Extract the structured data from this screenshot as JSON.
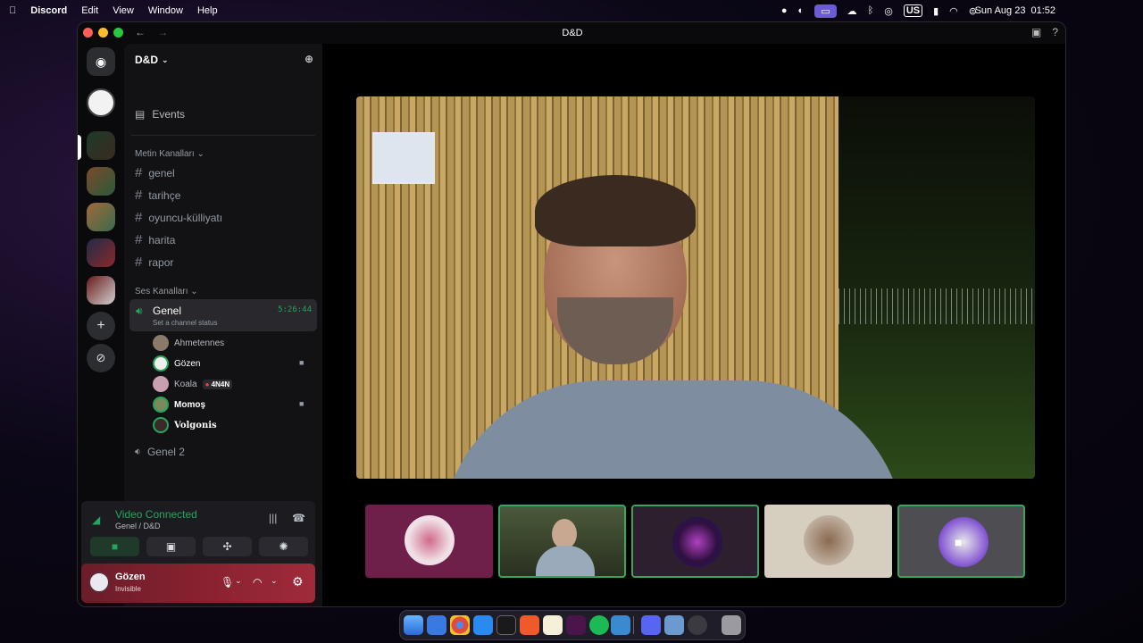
{
  "menubar": {
    "app_name": "Discord",
    "menus": [
      "Edit",
      "View",
      "Window",
      "Help"
    ],
    "input_source": "US",
    "date": "Sun Aug 23",
    "time": "01:52"
  },
  "window": {
    "title": "D&D"
  },
  "server": {
    "name": "D&D",
    "events_label": "Events",
    "text_category": "Metin Kanalları",
    "text_channels": [
      "genel",
      "tarihçe",
      "oyuncu-külliyatı",
      "harita",
      "rapor"
    ],
    "voice_category": "Ses Kanalları",
    "active_voice": {
      "name": "Genel",
      "status_prompt": "Set a channel status",
      "timer": "5:26:44"
    },
    "members": [
      {
        "name": "Ahmetennes",
        "camera": false,
        "tag": ""
      },
      {
        "name": "Gözen",
        "camera": true,
        "tag": ""
      },
      {
        "name": "Koala",
        "camera": false,
        "tag": "4N4N"
      },
      {
        "name": "Momoş",
        "camera": true,
        "tag": ""
      },
      {
        "name": "Volgonis",
        "camera": false,
        "tag": ""
      }
    ],
    "other_voice": "Genel 2"
  },
  "voice_panel": {
    "status": "Video Connected",
    "location": "Genel / D&D"
  },
  "user": {
    "name": "Gözen",
    "status": "Invisible"
  },
  "colors": {
    "accent_green": "#23a55a",
    "user_panel": "#8a2230",
    "speaking_border": "#3ba55d"
  }
}
